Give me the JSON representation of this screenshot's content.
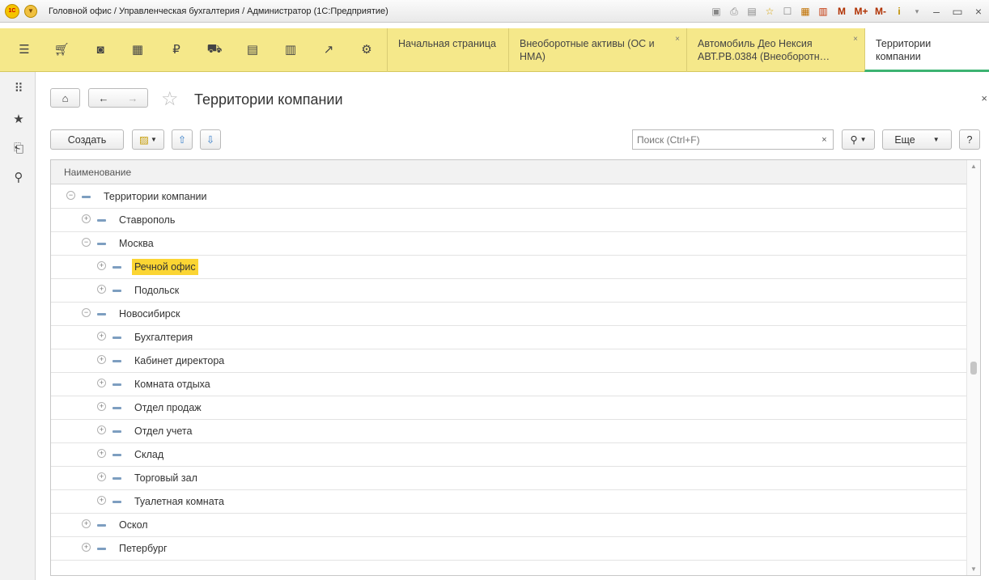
{
  "window": {
    "title": "Головной офис / Управленческая бухгалтерия / Администратор  (1С:Предприятие)",
    "logo_text": "1С"
  },
  "title_tools": {
    "m_label": "M",
    "m_plus_label": "M+",
    "m_minus_label": "M-",
    "info_label": "i"
  },
  "tabs": [
    {
      "label": "Начальная страница",
      "closable": false
    },
    {
      "label": "Внеоборотные активы (ОС и НМА)",
      "closable": true
    },
    {
      "label": "Автомобиль Део Нексия АВТ.РВ.0384  (Внеоборотн…",
      "closable": true
    },
    {
      "label": "Территории компании",
      "closable": false,
      "active": true
    }
  ],
  "form": {
    "title": "Территории компании",
    "create_label": "Создать",
    "more_label": "Еще",
    "help_label": "?",
    "close_label": "×"
  },
  "search": {
    "placeholder": "Поиск (Ctrl+F)",
    "clear_label": "×"
  },
  "table": {
    "column_header": "Наименование",
    "rows": [
      {
        "label": "Территории компании",
        "level": 0,
        "expanded": true,
        "selected": false
      },
      {
        "label": "Ставрополь",
        "level": 1,
        "expanded": false,
        "selected": false
      },
      {
        "label": "Москва",
        "level": 1,
        "expanded": true,
        "selected": false
      },
      {
        "label": "Речной офис",
        "level": 2,
        "expanded": false,
        "selected": true
      },
      {
        "label": "Подольск",
        "level": 2,
        "expanded": false,
        "selected": false
      },
      {
        "label": "Новосибирск",
        "level": 1,
        "expanded": true,
        "selected": false
      },
      {
        "label": "Бухгалтерия",
        "level": 2,
        "expanded": false,
        "selected": false
      },
      {
        "label": "Кабинет директора",
        "level": 2,
        "expanded": false,
        "selected": false
      },
      {
        "label": "Комната отдыха",
        "level": 2,
        "expanded": false,
        "selected": false
      },
      {
        "label": "Отдел продаж",
        "level": 2,
        "expanded": false,
        "selected": false
      },
      {
        "label": "Отдел учета",
        "level": 2,
        "expanded": false,
        "selected": false
      },
      {
        "label": "Склад",
        "level": 2,
        "expanded": false,
        "selected": false
      },
      {
        "label": "Торговый зал",
        "level": 2,
        "expanded": false,
        "selected": false
      },
      {
        "label": "Туалетная комната",
        "level": 2,
        "expanded": false,
        "selected": false
      },
      {
        "label": "Оскол",
        "level": 1,
        "expanded": false,
        "selected": false
      },
      {
        "label": "Петербург",
        "level": 1,
        "expanded": false,
        "selected": false
      }
    ]
  },
  "colors": {
    "section_bar": "#f5e88a",
    "selection": "#fbd533",
    "active_tab_underline": "#3cb371"
  }
}
